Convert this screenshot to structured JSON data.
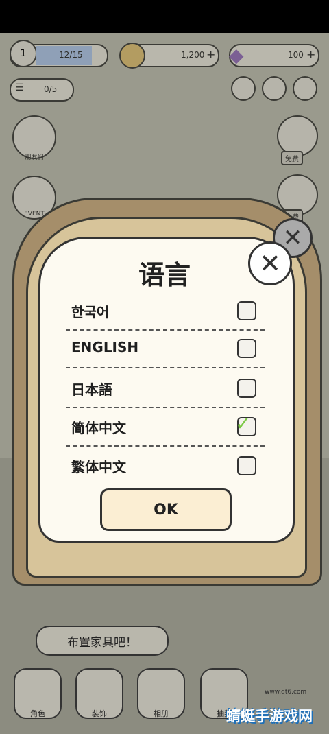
{
  "top": {
    "level": "1",
    "exp": "12/15",
    "coins": "1,200",
    "gems": "100",
    "tasks": "0/5"
  },
  "side": {
    "friends_label": "朋友们",
    "event_label": "EVENT",
    "free1": "免费",
    "free2": "免费"
  },
  "dialog": {
    "title": "语言",
    "options": [
      {
        "label": "한국어",
        "checked": false
      },
      {
        "label": "ENGLISH",
        "checked": false
      },
      {
        "label": "日本語",
        "checked": false
      },
      {
        "label": "简体中文",
        "checked": true
      },
      {
        "label": "繁体中文",
        "checked": false
      }
    ],
    "ok_label": "OK"
  },
  "hint": "布置家具吧！",
  "bottom": {
    "role": "角色",
    "decor": "装饰",
    "album": "相册",
    "draw": "抽奖"
  },
  "watermark": {
    "text": "蜻蜓手游戏网",
    "sub": "www.qt6.com"
  }
}
